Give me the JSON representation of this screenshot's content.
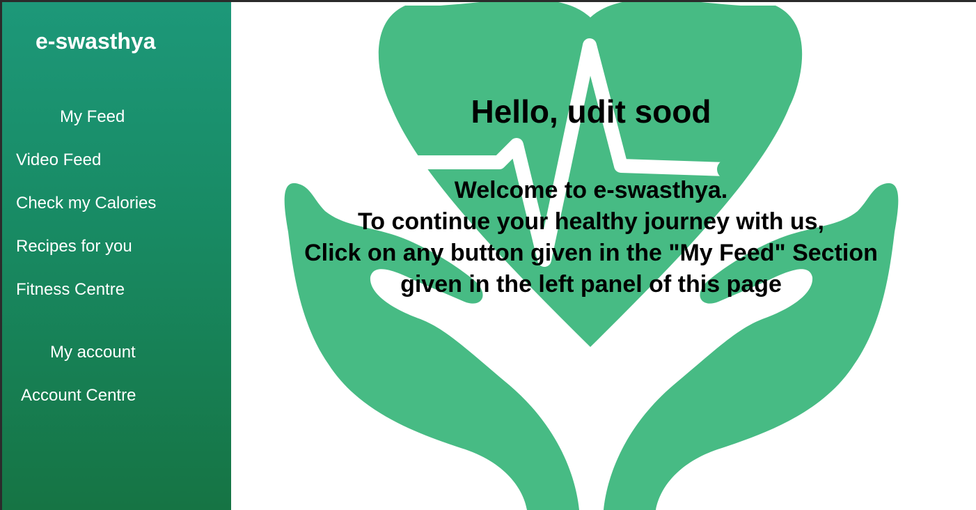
{
  "sidebar": {
    "brand": "e-swasthya",
    "feed_heading": "My Feed",
    "feed_items": [
      {
        "label": "Video Feed"
      },
      {
        "label": "Check my Calories"
      },
      {
        "label": "Recipes for you"
      },
      {
        "label": "Fitness Centre"
      }
    ],
    "account_heading": "My account",
    "account_items": [
      {
        "label": "Account Centre"
      }
    ]
  },
  "main": {
    "greeting": "Hello, udit sood",
    "welcome_lines": [
      "Welcome to e-swasthya.",
      "To continue your healthy journey with us,",
      "Click on any button given in the \"My Feed\" Section",
      "given in the left panel of this page"
    ],
    "background_icon": "heart-in-hands-icon"
  },
  "colors": {
    "sidebar_top": "#1d9879",
    "sidebar_bottom": "#167444",
    "illustration_green": "#47bb84",
    "text_dark": "#000000",
    "text_light": "#ffffff"
  }
}
